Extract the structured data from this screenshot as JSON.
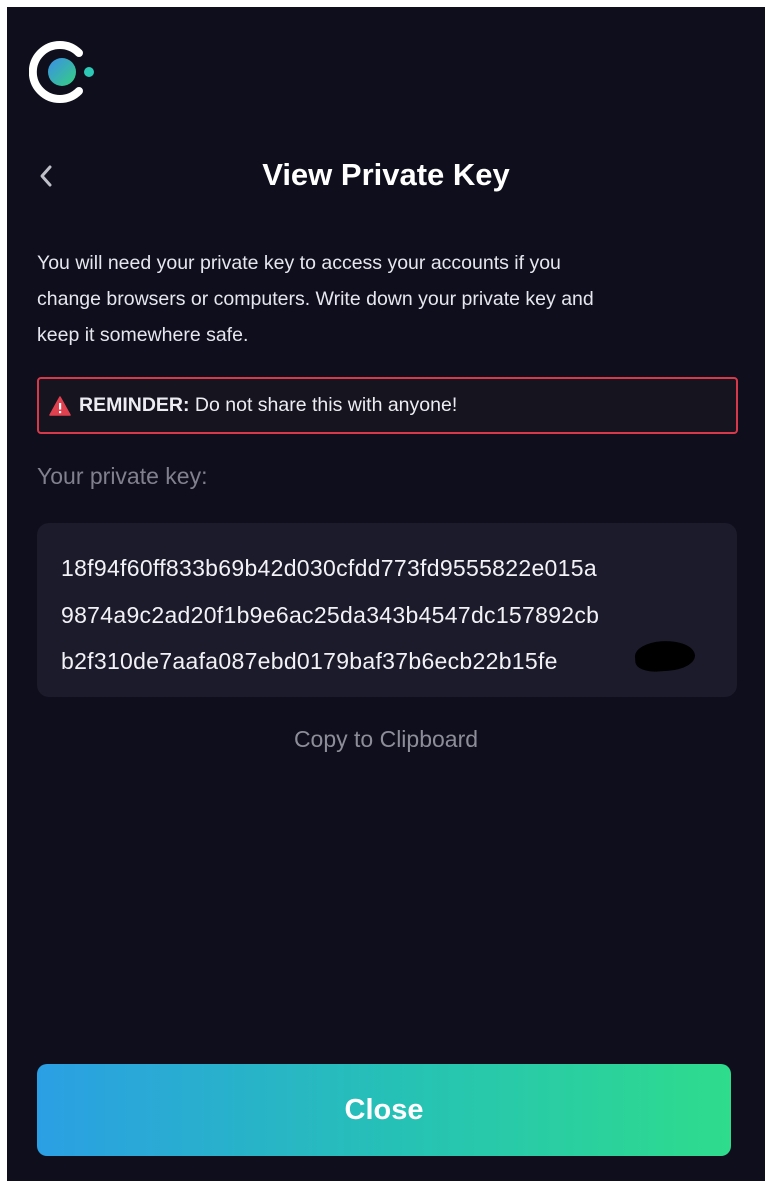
{
  "header": {
    "logo_icon": "celo-logo-icon",
    "back_icon": "chevron-left-icon",
    "title": "View Private Key"
  },
  "description": {
    "line1": "You will need your private key to access your accounts if you",
    "line2": "change browsers or computers. Write down your private key and",
    "line3": "keep it somewhere safe."
  },
  "reminder": {
    "icon": "warning-triangle-icon",
    "label": "REMINDER:",
    "text": " Do not share this with anyone!"
  },
  "private_key": {
    "label": "Your private key:",
    "lines": [
      "18f94f60ff833b69b42d030cfdd773fd9555822e015a",
      "9874a9c2ad20f1b9e6ac25da343b4547dc157892cb",
      "b2f310de7aafa087ebd0179baf37b6ecb22b15fe"
    ]
  },
  "copy_label": "Copy to Clipboard",
  "close_label": "Close",
  "colors": {
    "background": "#0e0e1c",
    "card": "#1c1b2b",
    "warning_border": "#d7394a",
    "button_gradient_start": "#2b9fe4",
    "button_gradient_end": "#2edc8c",
    "logo_ring": "#ffffff",
    "logo_dot": "#35d07f"
  }
}
